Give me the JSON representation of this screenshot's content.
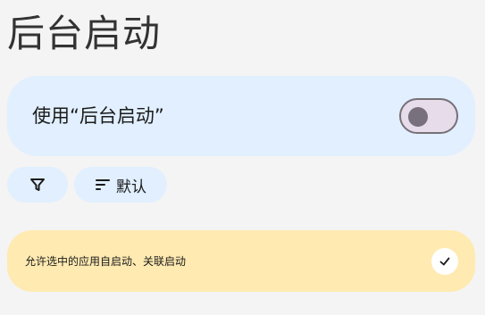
{
  "page": {
    "title": "后台启动"
  },
  "use_setting": {
    "label": "使用“后台启动”",
    "enabled": false
  },
  "filters": {
    "filter_icon": "filter-icon",
    "sort_icon": "sort-icon",
    "sort_label": "默认"
  },
  "notice": {
    "text": "允许选中的应用自启动、关联启动",
    "check_icon": "check-icon"
  },
  "colors": {
    "card_blue": "#e1efff",
    "notice_yellow": "#ffeab1",
    "background": "#f4f4f4",
    "toggle_track": "#e6dcea",
    "toggle_outline": "#777078"
  }
}
